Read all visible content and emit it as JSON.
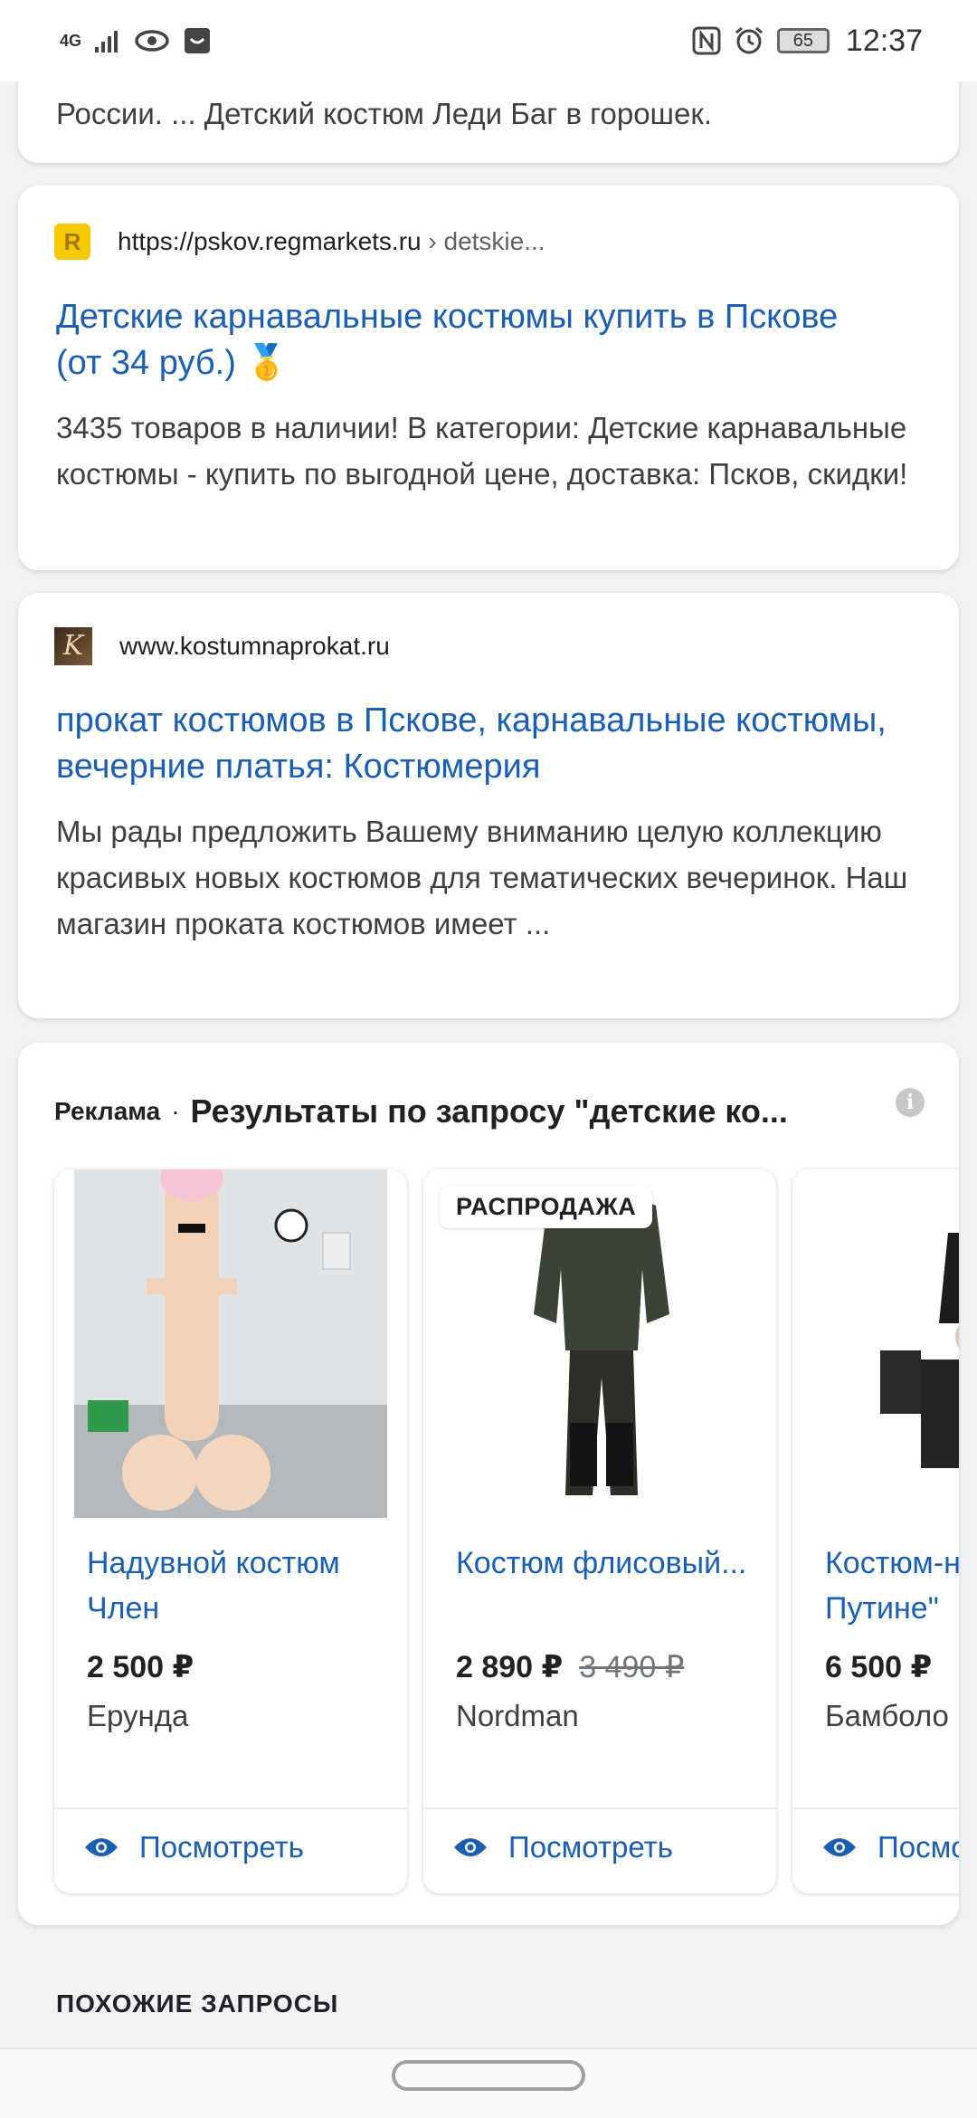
{
  "status_bar": {
    "network": "4G",
    "battery": "65",
    "time": "12:37"
  },
  "results": [
    {
      "snippet_tail": "России. ... Детский костюм Леди Баг в горошек."
    },
    {
      "favicon_letter": "R",
      "url_host": "https://pskov.regmarkets.ru",
      "url_path": " › detskie...",
      "title": "Детские карнавальные костюмы купить в Пскове (от 34 руб.) 🥇",
      "snippet": "3435 товаров в наличии! В категории: Детские карнавальные костюмы - купить по выгодной цене, доставка: Псков, скидки!"
    },
    {
      "favicon_letter": "K",
      "url_host": "www.kostumnaprokat.ru",
      "title": "прокат костюмов в Пскове, карнавальные костюмы, вечерние платья: Костюмерия",
      "snippet": "Мы рады предложить Вашему вниманию целую коллекцию красивых новых костюмов для тематических вечеринок. Наш магазин проката костюмов имеет ..."
    }
  ],
  "ads": {
    "label": "Реклама",
    "separator": "·",
    "title": "Результаты по запросу \"детские ко...",
    "info_icon": "i",
    "products": [
      {
        "name": "Надувной костюм Член",
        "price": "2 500 ₽",
        "old_price": "",
        "seller": "Ерунда",
        "view_label": "Посмотреть",
        "badge": ""
      },
      {
        "name": "Костюм флисовый...",
        "price": "2 890 ₽",
        "old_price": "3 490 ₽",
        "seller": "Nordman",
        "view_label": "Посмотреть",
        "badge": "РАСПРОДАЖА"
      },
      {
        "name": "Костюм-наездник \"Верхом на Путине\"",
        "price": "6 500 ₽",
        "old_price": "",
        "seller": "Бамболо",
        "view_label": "Посмотреть",
        "badge": ""
      }
    ]
  },
  "related_heading": "ПОХОЖИЕ ЗАПРОСЫ",
  "colors": {
    "link": "#1a5fb4",
    "background": "#f1f3f4",
    "card": "#ffffff"
  }
}
